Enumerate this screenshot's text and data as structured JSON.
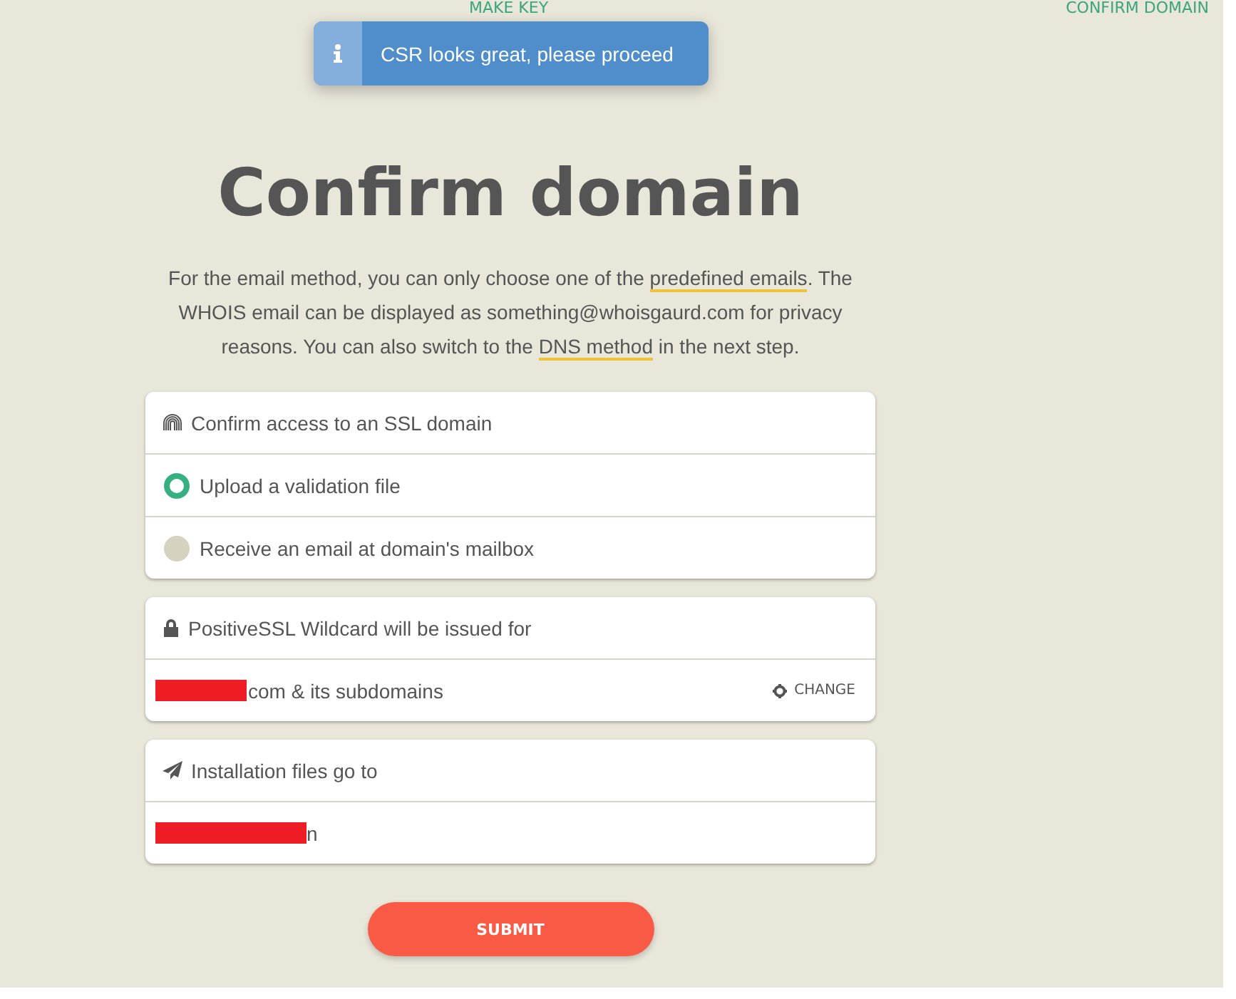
{
  "steps": [
    {
      "label": "MAKE KEY"
    },
    {
      "label": "CONFIRM DOMAIN"
    }
  ],
  "toast": {
    "message": "CSR looks great, please proceed"
  },
  "title": "Confirm domain",
  "intro": [
    {
      "kind": "text",
      "text": "For the email method, you can only choose one of the "
    },
    {
      "kind": "link",
      "text": "predefined emails"
    },
    {
      "kind": "text",
      "text": ". The WHOIS email can be displayed as something@whoisgaurd.com for privacy reasons. You can also switch to the "
    },
    {
      "kind": "link",
      "text": "DNS method"
    },
    {
      "kind": "text",
      "text": " in the next step."
    }
  ],
  "validation": {
    "title": "Confirm access to an SSL domain",
    "options": [
      {
        "label": "Upload a validation file",
        "selected": true
      },
      {
        "label": "Receive an email at domain's mailbox",
        "selected": false
      }
    ]
  },
  "issued": {
    "title": "PositiveSSL Wildcard will be issued for",
    "value": "com & its subdomains",
    "action": "CHANGE"
  },
  "installation": {
    "title": "Installation files go to",
    "value": "n"
  },
  "submit": "SUBMIT"
}
